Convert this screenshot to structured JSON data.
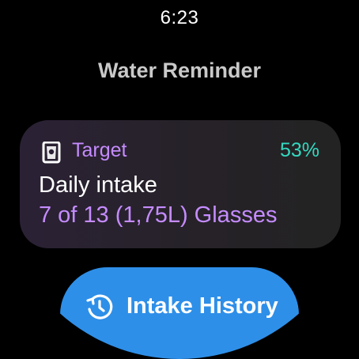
{
  "status": {
    "time": "6:23"
  },
  "app": {
    "title": "Water Reminder"
  },
  "target_card": {
    "icon": "glass-icon",
    "label": "Target",
    "percent": "53%",
    "metric_label": "Daily intake",
    "metric_value": "7 of 13 (1,75L) Glasses",
    "colors": {
      "label": "#c58cff",
      "percent": "#33d9c0",
      "card_bg": "#262228"
    }
  },
  "history_button": {
    "icon": "history-icon",
    "label": "Intake History",
    "color": "#2e8fe8"
  }
}
